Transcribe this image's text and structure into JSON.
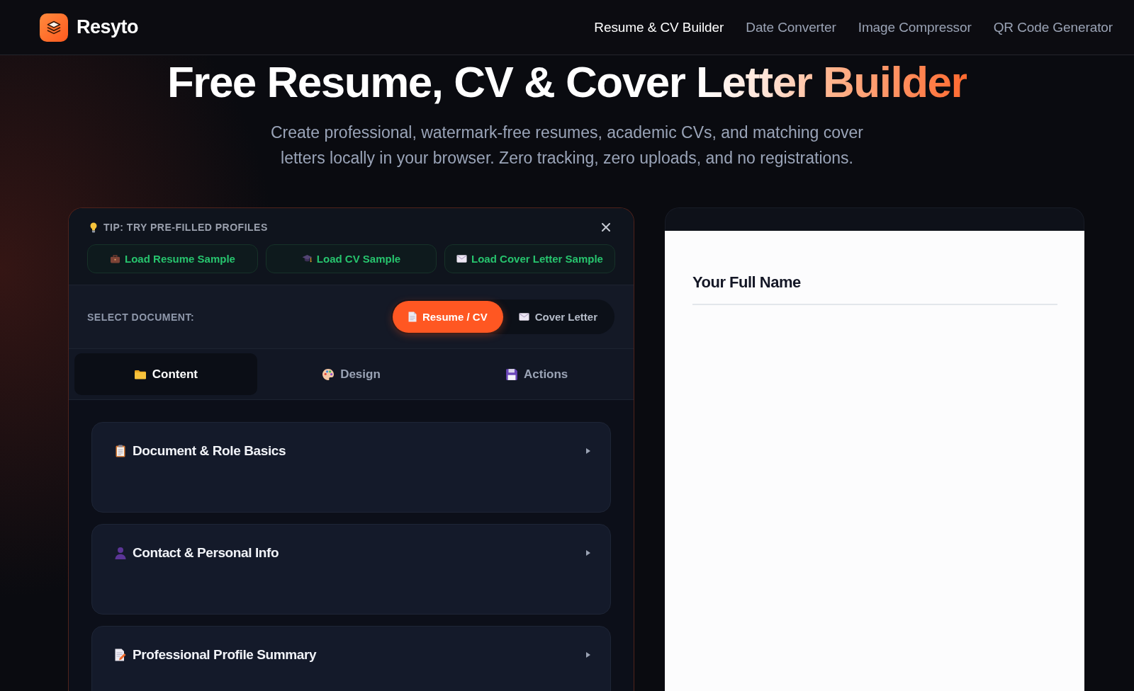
{
  "header": {
    "logo": "Resyto",
    "nav": [
      {
        "label": "Resume & CV Builder",
        "selected": true
      },
      {
        "label": "Date Converter",
        "selected": false
      },
      {
        "label": "Image Compressor",
        "selected": false
      },
      {
        "label": "QR Code Generator",
        "selected": false
      }
    ]
  },
  "hero": {
    "title": "Free Resume, CV & Cover Letter Builder",
    "subtitle": "Create professional, watermark-free resumes, academic CVs, and matching cover letters locally in your browser. Zero tracking, zero uploads, and no registrations."
  },
  "editor": {
    "tip": {
      "title": "TIP: TRY PRE-FILLED PROFILES",
      "buttons": [
        "Load Resume Sample",
        "Load CV Sample",
        "Load Cover Letter Sample"
      ]
    },
    "document_select": {
      "label": "SELECT DOCUMENT:",
      "options": [
        {
          "label": "Resume / CV",
          "selected": true
        },
        {
          "label": "Cover Letter",
          "selected": false
        }
      ]
    },
    "tabs": [
      {
        "label": "Content",
        "selected": true
      },
      {
        "label": "Design",
        "selected": false
      },
      {
        "label": "Actions",
        "selected": false
      }
    ],
    "sections": [
      {
        "title": "Document & Role Basics",
        "expanded": false
      },
      {
        "title": "Contact & Personal Info",
        "expanded": false
      },
      {
        "title": "Professional Profile Summary",
        "expanded": false
      }
    ]
  },
  "preview": {
    "name": "Your Full Name"
  }
}
